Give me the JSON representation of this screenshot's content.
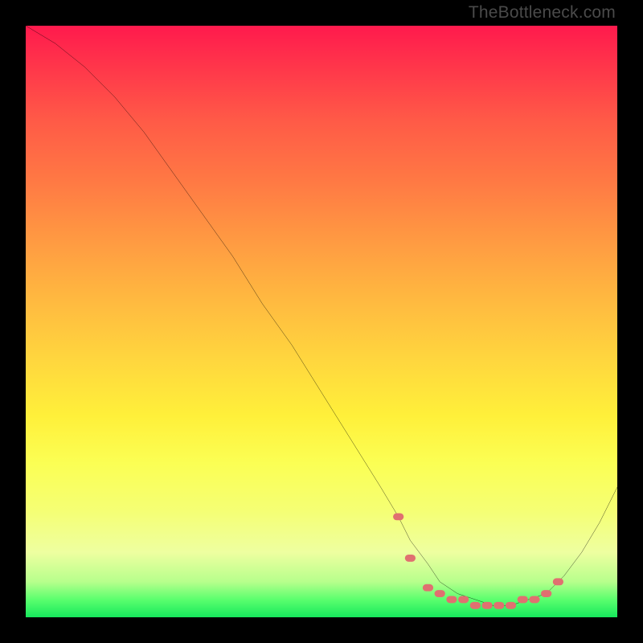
{
  "source_watermark": "TheBottleneck.com",
  "chart_data": {
    "type": "line",
    "title": "",
    "xlabel": "",
    "ylabel": "",
    "xlim": [
      0,
      100
    ],
    "ylim": [
      0,
      100
    ],
    "background_gradient": {
      "orientation": "vertical",
      "stops": [
        {
          "pos": 0,
          "color": "#ff1a4d"
        },
        {
          "pos": 50,
          "color": "#ffc040"
        },
        {
          "pos": 80,
          "color": "#fcff60"
        },
        {
          "pos": 100,
          "color": "#16e85c"
        }
      ]
    },
    "series": [
      {
        "name": "bottleneck-curve",
        "color": "#000000",
        "x": [
          0,
          5,
          10,
          15,
          20,
          25,
          30,
          35,
          40,
          45,
          50,
          55,
          60,
          63,
          65,
          68,
          70,
          73,
          76,
          79,
          82,
          85,
          88,
          91,
          94,
          97,
          100
        ],
        "values": [
          100,
          97,
          93,
          88,
          82,
          75,
          68,
          61,
          53,
          46,
          38,
          30,
          22,
          17,
          13,
          9,
          6,
          4,
          3,
          2,
          2,
          3,
          4,
          7,
          11,
          16,
          22
        ]
      },
      {
        "name": "optimal-zone-markers",
        "color": "#e07070",
        "marker": "dot",
        "x": [
          63,
          65,
          68,
          70,
          72,
          74,
          76,
          78,
          80,
          82,
          84,
          86,
          88,
          90
        ],
        "values": [
          17,
          10,
          5,
          4,
          3,
          3,
          2,
          2,
          2,
          2,
          3,
          3,
          4,
          6
        ]
      }
    ]
  }
}
